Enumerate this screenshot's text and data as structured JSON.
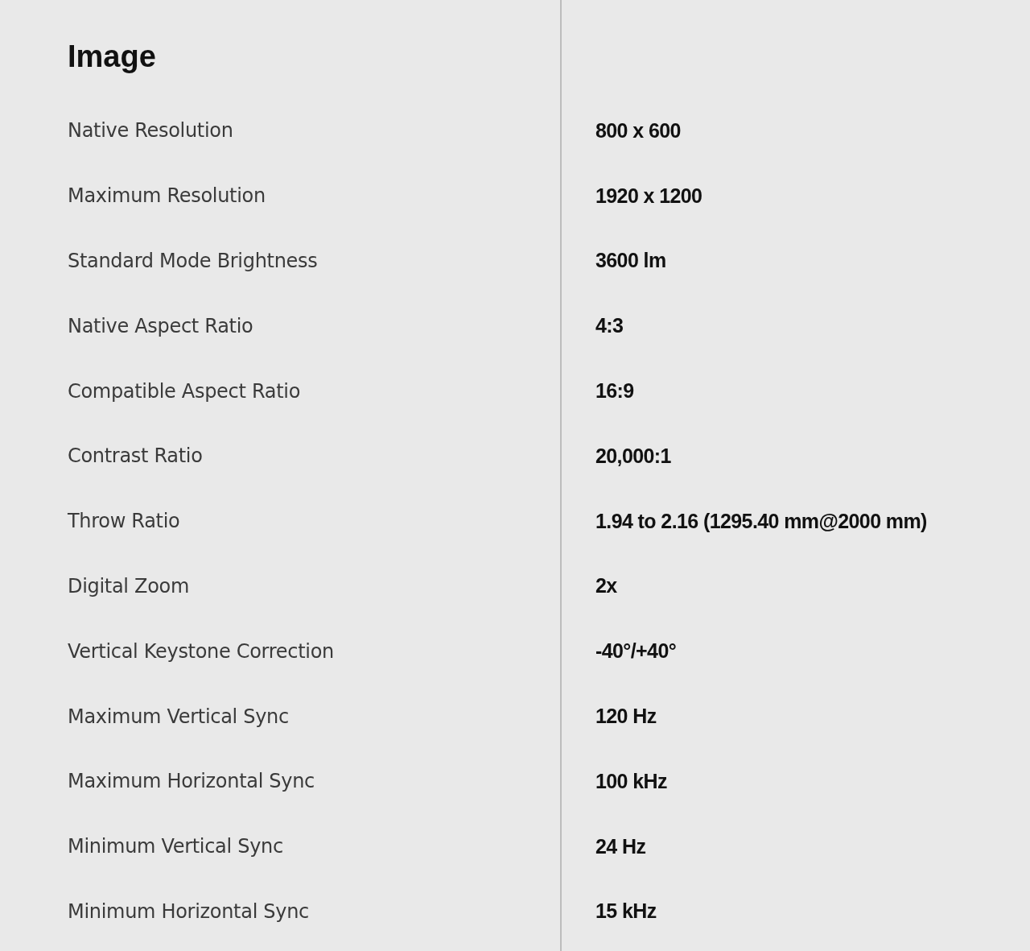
{
  "section": {
    "title": "Image",
    "specs": [
      {
        "label": "Native Resolution",
        "value": "800 x 600"
      },
      {
        "label": "Maximum Resolution",
        "value": "1920 x 1200"
      },
      {
        "label": "Standard Mode Brightness",
        "value": "3600 lm"
      },
      {
        "label": "Native Aspect Ratio",
        "value": "4:3"
      },
      {
        "label": "Compatible Aspect Ratio",
        "value": "16:9"
      },
      {
        "label": "Contrast Ratio",
        "value": "20,000:1"
      },
      {
        "label": "Throw Ratio",
        "value": "1.94 to 2.16 (1295.40 mm@2000 mm)"
      },
      {
        "label": "Digital Zoom",
        "value": "2x"
      },
      {
        "label": "Vertical Keystone Correction",
        "value": "-40°/+40°"
      },
      {
        "label": "Maximum Vertical Sync",
        "value": "120 Hz"
      },
      {
        "label": "Maximum Horizontal Sync",
        "value": "100 kHz"
      },
      {
        "label": "Minimum Vertical Sync",
        "value": "24 Hz"
      },
      {
        "label": "Minimum Horizontal Sync",
        "value": "15 kHz"
      }
    ]
  }
}
